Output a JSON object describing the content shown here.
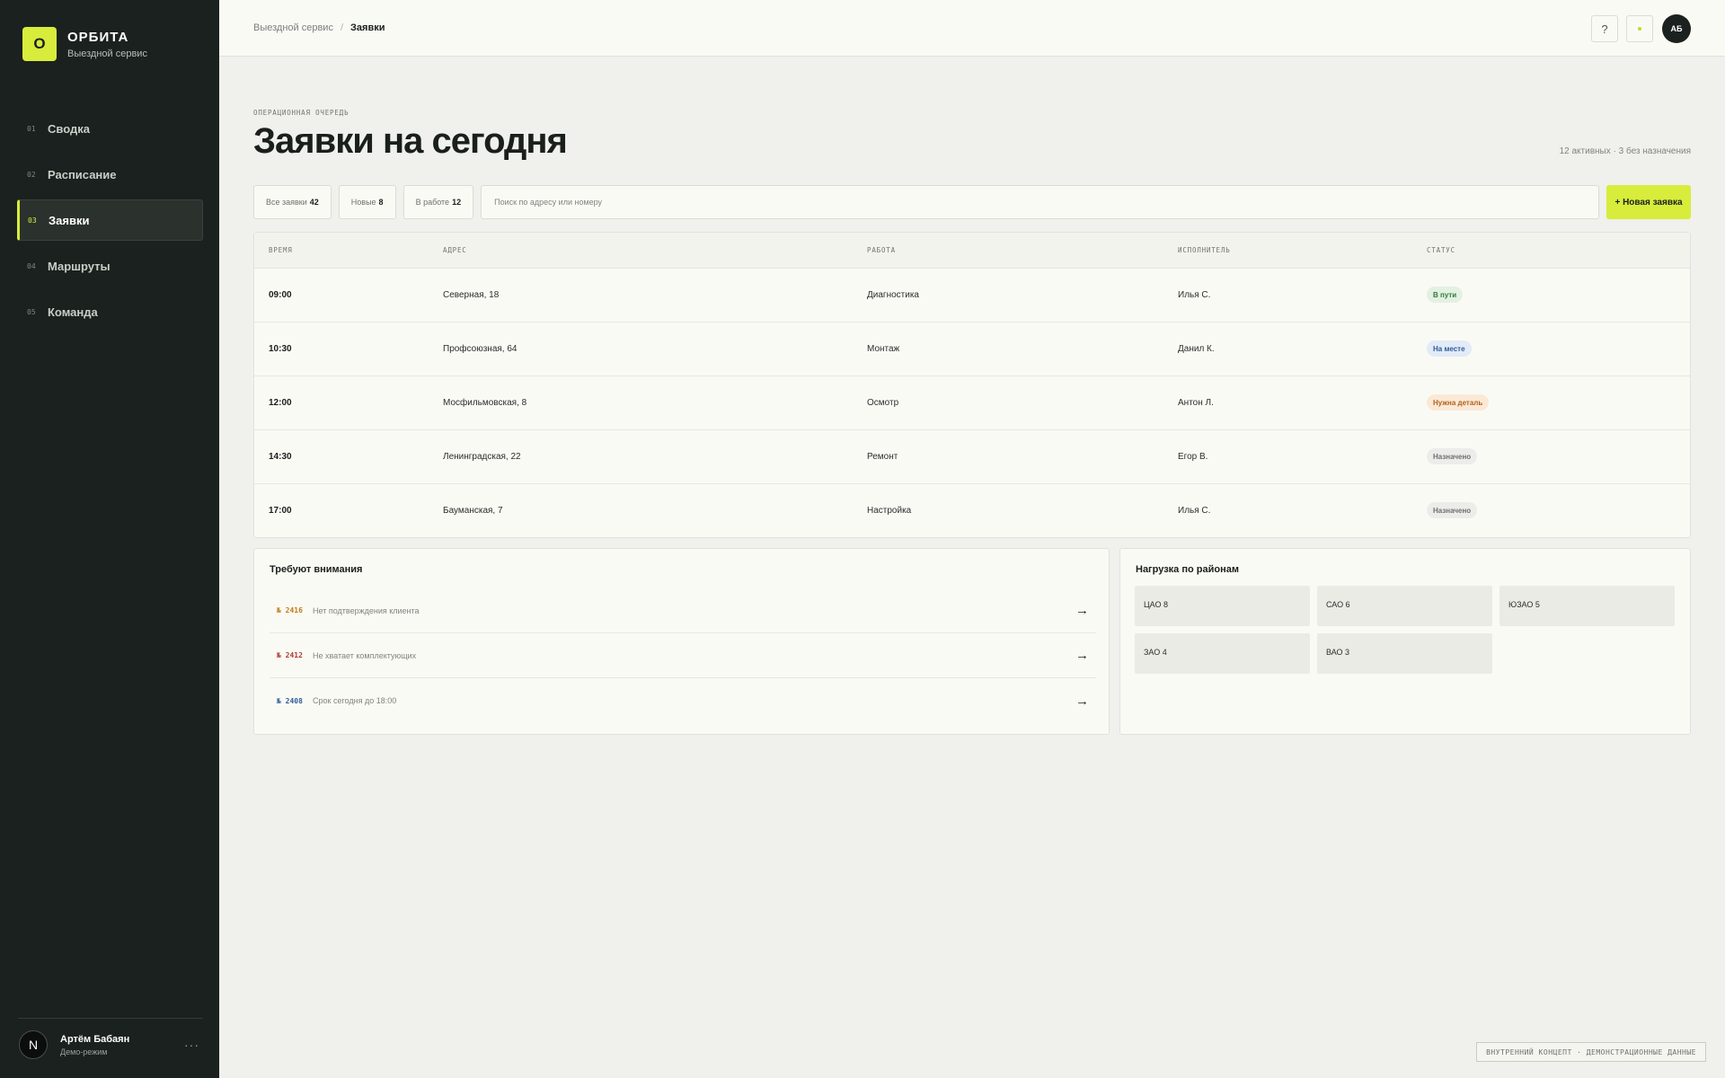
{
  "brand": {
    "logo_letter": "О",
    "name": "ОРБИТА",
    "subtitle": "Выездной сервис"
  },
  "sidebar": {
    "items": [
      {
        "num": "01",
        "label": "Сводка",
        "active": false
      },
      {
        "num": "02",
        "label": "Расписание",
        "active": false
      },
      {
        "num": "03",
        "label": "Заявки",
        "active": true
      },
      {
        "num": "04",
        "label": "Маршруты",
        "active": false
      },
      {
        "num": "05",
        "label": "Команда",
        "active": false
      }
    ]
  },
  "user": {
    "avatar_letter": "N",
    "name": "Артём Бабаян",
    "role": "Демо-режим",
    "more": "···"
  },
  "breadcrumb": {
    "parent": "Выездной сервис",
    "separator": "/",
    "current": "Заявки"
  },
  "topbar": {
    "help_label": "?",
    "avatar_initials": "АБ"
  },
  "header": {
    "kicker": "ОПЕРАЦИОННАЯ ОЧЕРЕДЬ",
    "title": "Заявки на сегодня",
    "summary": "12 активных · 3 без назначения"
  },
  "filters": [
    {
      "label": "Все заявки",
      "count": "42"
    },
    {
      "label": "Новые",
      "count": "8"
    },
    {
      "label": "В работе",
      "count": "12"
    }
  ],
  "search": {
    "placeholder": "Поиск по адресу или номеру",
    "value": ""
  },
  "new_button": {
    "label": "+ Новая заявка"
  },
  "table": {
    "headers": [
      "ВРЕМЯ",
      "АДРЕС",
      "РАБОТА",
      "ИСПОЛНИТЕЛЬ",
      "СТАТУС"
    ],
    "rows": [
      {
        "time": "09:00",
        "address": "Северная, 18",
        "work": "Диагностика",
        "assignee": "Илья С.",
        "status": "В пути"
      },
      {
        "time": "10:30",
        "address": "Профсоюзная, 64",
        "work": "Монтаж",
        "assignee": "Данил К.",
        "status": "На месте"
      },
      {
        "time": "12:00",
        "address": "Мосфильмовская, 8",
        "work": "Осмотр",
        "assignee": "Антон Л.",
        "status": "Нужна деталь"
      },
      {
        "time": "14:30",
        "address": "Ленинградская, 22",
        "work": "Ремонт",
        "assignee": "Егор В.",
        "status": "Назначено"
      },
      {
        "time": "17:00",
        "address": "Бауманская, 7",
        "work": "Настройка",
        "assignee": "Илья С.",
        "status": "Назначено"
      }
    ]
  },
  "status_colors": {
    "В пути": {
      "bg": "#e3f1e2",
      "fg": "#2f7a3a"
    },
    "На месте": {
      "bg": "#e2ebf7",
      "fg": "#2f5b9a"
    },
    "Нужна деталь": {
      "bg": "#fbe9d6",
      "fg": "#b0621d"
    },
    "Назначено": {
      "bg": "#ececea",
      "fg": "#6d726c"
    }
  },
  "attention": {
    "title": "Требуют внимания",
    "items": [
      {
        "num": "№ 2416",
        "text": "Нет подтверждения клиента",
        "color": "#c27a16",
        "arrow": "→"
      },
      {
        "num": "№ 2412",
        "text": "Не хватает комплектующих",
        "color": "#b03a2e",
        "arrow": "→"
      },
      {
        "num": "№ 2408",
        "text": "Срок сегодня до 18:00",
        "color": "#2f5b9a",
        "arrow": "→"
      }
    ]
  },
  "load": {
    "title": "Нагрузка по районам",
    "districts": [
      "ЦАО 8",
      "САО 6",
      "ЮЗАО 5",
      "ЗАО 4",
      "ВАО 3"
    ]
  },
  "footer": {
    "tag": "ВНУТРЕННИЙ КОНЦЕПТ · ДЕМОНСТРАЦИОННЫЕ ДАННЫЕ"
  },
  "colors": {
    "accent": "#d8ec3c",
    "sidebar_bg": "#1b211e",
    "page_bg": "#f0f0ec"
  }
}
